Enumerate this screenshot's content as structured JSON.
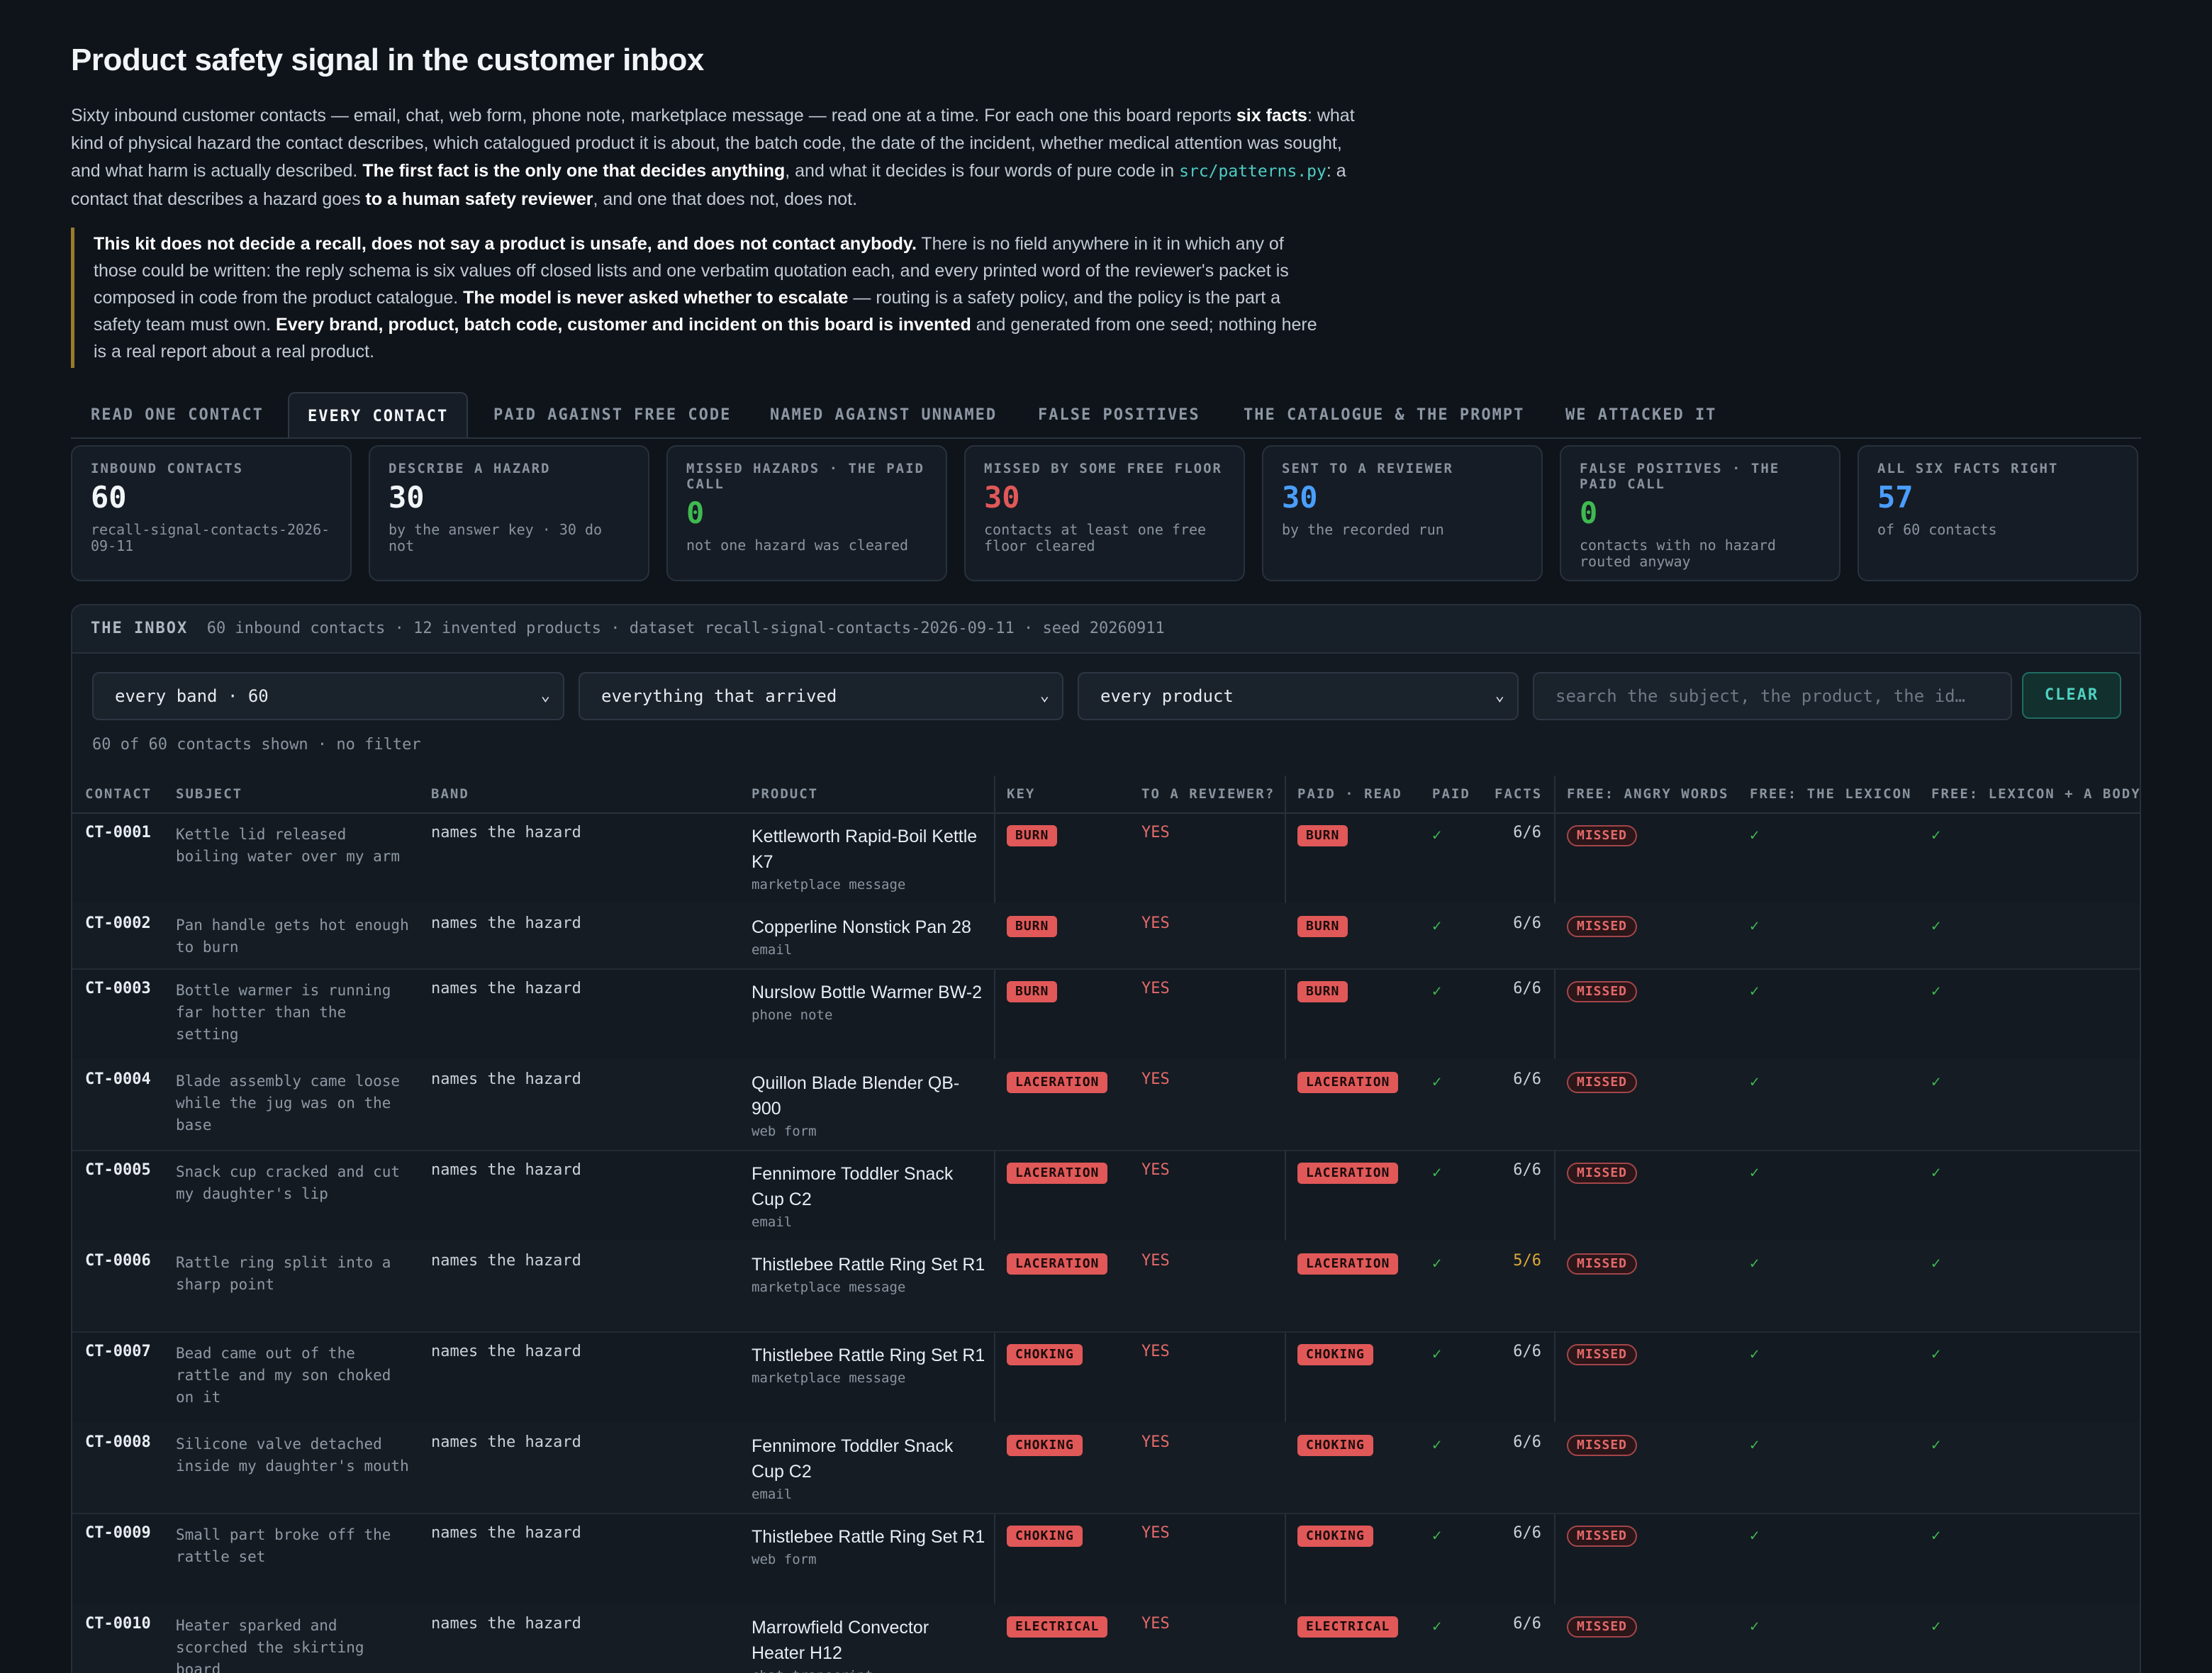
{
  "title": "Product safety signal in the customer inbox",
  "intro": {
    "p1_a": "Sixty inbound customer contacts — email, chat, web form, phone note, marketplace message — read one at a time. For each one this board reports ",
    "p1_b": "six facts",
    "p1_c": ": what kind of physical hazard the contact describes, which catalogued product it is about, the batch code, the date of the incident, whether medical attention was sought, and what harm is actually described. ",
    "p1_d": "The first fact is the only one that decides anything",
    "p1_e": ", and what it decides is four words of pure code in ",
    "p1_code": "src/patterns.py",
    "p1_f": ": a contact that describes a hazard goes ",
    "p1_g": "to a human safety reviewer",
    "p1_h": ", and one that does not, does not."
  },
  "callout": {
    "a": "This kit does not decide a recall, does not say a product is unsafe, and does not contact anybody.",
    "b": " There is no field anywhere in it in which any of those could be written: the reply schema is six values off closed lists and one verbatim quotation each, and every printed word of the reviewer's packet is composed in code from the product catalogue. ",
    "c": "The model is never asked whether to escalate",
    "d": " — routing is a safety policy, and the policy is the part a safety team must own. ",
    "e": "Every brand, product, batch code, customer and incident on this board is invented",
    "f": " and generated from one seed; nothing here is a real report about a real product."
  },
  "tabs": [
    "READ ONE CONTACT",
    "EVERY CONTACT",
    "PAID AGAINST FREE CODE",
    "NAMED AGAINST UNNAMED",
    "FALSE POSITIVES",
    "THE CATALOGUE & THE PROMPT",
    "WE ATTACKED IT"
  ],
  "stats": [
    {
      "label": "INBOUND CONTACTS",
      "value": "60",
      "sub": "recall-signal-contacts-2026-09-11",
      "color": "#f2f5f8"
    },
    {
      "label": "DESCRIBE A HAZARD",
      "value": "30",
      "sub": "by the answer key · 30 do not",
      "color": "#f2f5f8"
    },
    {
      "label": "MISSED HAZARDS · THE PAID CALL",
      "value": "0",
      "sub": "not one hazard was cleared",
      "color": "#3fb950"
    },
    {
      "label": "MISSED BY SOME FREE FLOOR",
      "value": "30",
      "sub": "contacts at least one free floor cleared",
      "color": "#e15858"
    },
    {
      "label": "SENT TO A REVIEWER",
      "value": "30",
      "sub": "by the recorded run",
      "color": "#4a9eff"
    },
    {
      "label": "FALSE POSITIVES · THE PAID CALL",
      "value": "0",
      "sub": "contacts with no hazard routed anyway",
      "color": "#3fb950"
    },
    {
      "label": "ALL SIX FACTS RIGHT",
      "value": "57",
      "sub": "of 60 contacts",
      "color": "#4a9eff"
    }
  ],
  "inbox": {
    "label": "THE INBOX",
    "meta": "60 inbound contacts · 12 invented products · dataset recall-signal-contacts-2026-09-11 · seed 20260911",
    "band_select": "every band · 60",
    "arrival_select": "everything that arrived",
    "product_select": "every product",
    "search_placeholder": "search the subject, the product, the id…",
    "clear_label": "CLEAR",
    "shown": "60 of 60 contacts shown · no filter"
  },
  "columns": [
    "CONTACT",
    "SUBJECT",
    "BAND",
    "PRODUCT",
    "KEY",
    "TO A REVIEWER?",
    "PAID · READ",
    "PAID",
    "FACTS",
    "FREE: ANGRY WORDS",
    "FREE: THE LEXICON",
    "FREE: LEXICON + A BODY"
  ],
  "rows": [
    {
      "id": "CT-0001",
      "subject": "Kettle lid released boiling water over my arm",
      "band": "names the hazard",
      "product": "Kettleworth Rapid-Boil Kettle K7",
      "channel": "marketplace message",
      "key": "BURN",
      "reviewer": "YES",
      "paid_read": "BURN",
      "paid": "✓",
      "facts": "6/6",
      "angry": "MISSED",
      "lexicon": "✓",
      "lexbody": "✓"
    },
    {
      "id": "CT-0002",
      "subject": "Pan handle gets hot enough to burn",
      "band": "names the hazard",
      "product": "Copperline Nonstick Pan 28",
      "channel": "email",
      "key": "BURN",
      "reviewer": "YES",
      "paid_read": "BURN",
      "paid": "✓",
      "facts": "6/6",
      "angry": "MISSED",
      "lexicon": "✓",
      "lexbody": "✓"
    },
    {
      "id": "CT-0003",
      "subject": "Bottle warmer is running far hotter than the setting",
      "band": "names the hazard",
      "product": "Nurslow Bottle Warmer BW-2",
      "channel": "phone note",
      "key": "BURN",
      "reviewer": "YES",
      "paid_read": "BURN",
      "paid": "✓",
      "facts": "6/6",
      "angry": "MISSED",
      "lexicon": "✓",
      "lexbody": "✓"
    },
    {
      "id": "CT-0004",
      "subject": "Blade assembly came loose while the jug was on the base",
      "band": "names the hazard",
      "product": "Quillon Blade Blender QB-900",
      "channel": "web form",
      "key": "LACERATION",
      "reviewer": "YES",
      "paid_read": "LACERATION",
      "paid": "✓",
      "facts": "6/6",
      "angry": "MISSED",
      "lexicon": "✓",
      "lexbody": "✓"
    },
    {
      "id": "CT-0005",
      "subject": "Snack cup cracked and cut my daughter's lip",
      "band": "names the hazard",
      "product": "Fennimore Toddler Snack Cup C2",
      "channel": "email",
      "key": "LACERATION",
      "reviewer": "YES",
      "paid_read": "LACERATION",
      "paid": "✓",
      "facts": "6/6",
      "angry": "MISSED",
      "lexicon": "✓",
      "lexbody": "✓"
    },
    {
      "id": "CT-0006",
      "subject": "Rattle ring split into a sharp point",
      "band": "names the hazard",
      "product": "Thistlebee Rattle Ring Set R1",
      "channel": "marketplace message",
      "key": "LACERATION",
      "reviewer": "YES",
      "paid_read": "LACERATION",
      "paid": "✓",
      "facts": "5/6",
      "angry": "MISSED",
      "lexicon": "✓",
      "lexbody": "✓"
    },
    {
      "id": "CT-0007",
      "subject": "Bead came out of the rattle and my son choked on it",
      "band": "names the hazard",
      "product": "Thistlebee Rattle Ring Set R1",
      "channel": "marketplace message",
      "key": "CHOKING",
      "reviewer": "YES",
      "paid_read": "CHOKING",
      "paid": "✓",
      "facts": "6/6",
      "angry": "MISSED",
      "lexicon": "✓",
      "lexbody": "✓"
    },
    {
      "id": "CT-0008",
      "subject": "Silicone valve detached inside my daughter's mouth",
      "band": "names the hazard",
      "product": "Fennimore Toddler Snack Cup C2",
      "channel": "email",
      "key": "CHOKING",
      "reviewer": "YES",
      "paid_read": "CHOKING",
      "paid": "✓",
      "facts": "6/6",
      "angry": "MISSED",
      "lexicon": "✓",
      "lexbody": "✓"
    },
    {
      "id": "CT-0009",
      "subject": "Small part broke off the rattle set",
      "band": "names the hazard",
      "product": "Thistlebee Rattle Ring Set R1",
      "channel": "web form",
      "key": "CHOKING",
      "reviewer": "YES",
      "paid_read": "CHOKING",
      "paid": "✓",
      "facts": "6/6",
      "angry": "MISSED",
      "lexicon": "✓",
      "lexbody": "✓"
    },
    {
      "id": "CT-0010",
      "subject": "Heater sparked and scorched the skirting board",
      "band": "names the hazard",
      "product": "Marrowfield Convector Heater H12",
      "channel": "chat transcript",
      "key": "ELECTRICAL",
      "reviewer": "YES",
      "paid_read": "ELECTRICAL",
      "paid": "✓",
      "facts": "6/6",
      "angry": "MISSED",
      "lexicon": "✓",
      "lexbody": "✓"
    }
  ]
}
